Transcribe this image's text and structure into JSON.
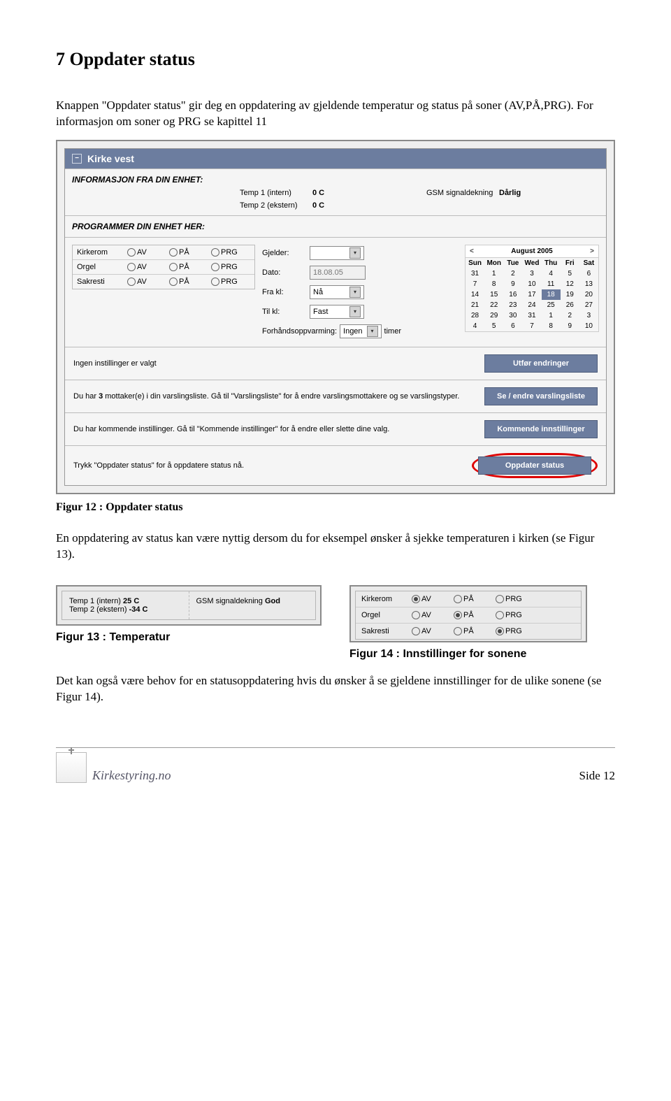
{
  "section_heading": "7  Oppdater status",
  "intro_p": "Knappen \"Oppdater status\" gir deg en oppdatering av gjeldende temperatur og status på soner (AV,PÅ,PRG). For informasjon om soner og PRG se kapittel 11",
  "caption12": "Figur 12 : Oppdater status",
  "mid_p": "En oppdatering av status kan være nyttig dersom du for eksempel ønsker å sjekke temperaturen i kirken (se Figur 13).",
  "caption13": "Figur 13 : Temperatur",
  "caption14": "Figur 14 : Innstillinger for sonene",
  "end_p": "Det kan også være behov for en statusoppdatering hvis du ønsker å se gjeldene innstillinger for de ulike sonene (se             Figur 14).",
  "page_label": "Side 12",
  "logo_text": "Kirkestyring.no",
  "app": {
    "title": "Kirke vest",
    "info_header": "INFORMASJON FRA DIN ENHET:",
    "temp1_label": "Temp 1 (intern)",
    "temp1_val": "0 C",
    "temp2_label": "Temp 2 (ekstern)",
    "temp2_val": "0 C",
    "gsm_label": "GSM signaldekning",
    "gsm_val": "Dårlig",
    "prog_header": "PROGRAMMER DIN ENHET HER:",
    "zones": [
      {
        "name": "Kirkerom",
        "av": "AV",
        "pa": "PÅ",
        "prg": "PRG"
      },
      {
        "name": "Orgel",
        "av": "AV",
        "pa": "PÅ",
        "prg": "PRG"
      },
      {
        "name": "Sakresti",
        "av": "AV",
        "pa": "PÅ",
        "prg": "PRG"
      }
    ],
    "gjelder_label": "Gjelder:",
    "dato_label": "Dato:",
    "dato_val": "18.08.05",
    "fra_label": "Fra kl:",
    "fra_val": "Nå",
    "til_label": "Til kl:",
    "til_val": "Fast",
    "forh_label": "Forhåndsoppvarming:",
    "forh_val": "Ingen",
    "forh_unit": "timer",
    "calendar": {
      "month": "August 2005",
      "dow": [
        "Sun",
        "Mon",
        "Tue",
        "Wed",
        "Thu",
        "Fri",
        "Sat"
      ],
      "weeks": [
        [
          "31",
          "1",
          "2",
          "3",
          "4",
          "5",
          "6"
        ],
        [
          "7",
          "8",
          "9",
          "10",
          "11",
          "12",
          "13"
        ],
        [
          "14",
          "15",
          "16",
          "17",
          "18",
          "19",
          "20"
        ],
        [
          "21",
          "22",
          "23",
          "24",
          "25",
          "26",
          "27"
        ],
        [
          "28",
          "29",
          "30",
          "31",
          "1",
          "2",
          "3"
        ],
        [
          "4",
          "5",
          "6",
          "7",
          "8",
          "9",
          "10"
        ]
      ],
      "today": "18"
    },
    "row1_txt": "Ingen instillinger er valgt",
    "btn1": "Utfør endringer",
    "row2_left": "Du har ",
    "row2_bold": "3",
    "row2_right": " mottaker(e) i din varslingsliste. Gå til \"Varslingsliste\" for å endre varslingsmottakere og se varslingstyper.",
    "btn2": "Se / endre varslingsliste",
    "row3_txt": "Du har kommende instillinger. Gå til \"Kommende instillinger\" for å endre eller slette dine valg.",
    "btn3": "Kommende innstillinger",
    "row4_txt": "Trykk \"Oppdater status\" for å oppdatere status nå.",
    "btn4": "Oppdater status"
  },
  "snip_temp": {
    "t1_label": "Temp 1 (intern) ",
    "t1_val": "25 C",
    "t2_label": "Temp 2 (ekstern) ",
    "t2_val": "-34 C",
    "gsm_label": "GSM signaldekning ",
    "gsm_val": "God"
  },
  "snip_zones": {
    "rows": [
      {
        "name": "Kirkerom",
        "sel": "av"
      },
      {
        "name": "Orgel",
        "sel": "pa"
      },
      {
        "name": "Sakresti",
        "sel": "prg"
      }
    ],
    "av": "AV",
    "pa": "PÅ",
    "prg": "PRG"
  }
}
